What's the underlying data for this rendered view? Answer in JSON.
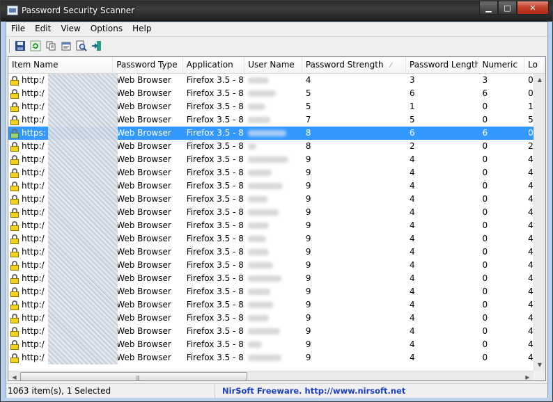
{
  "window": {
    "title": "Password Security Scanner"
  },
  "menu": [
    "File",
    "Edit",
    "View",
    "Options",
    "Help"
  ],
  "columns": [
    "Item Name",
    "Password Type",
    "Application",
    "User Name",
    "Password Strength",
    "Password Length",
    "Numeric",
    "Lo"
  ],
  "rows": [
    {
      "item": "http:/",
      "type": "Web Browser",
      "app": "Firefox 3.5 - 8",
      "strength": "4",
      "length": "3",
      "numeric": "3",
      "lo": "0"
    },
    {
      "item": "http:/",
      "type": "Web Browser",
      "app": "Firefox 3.5 - 8",
      "strength": "5",
      "length": "6",
      "numeric": "6",
      "lo": "0"
    },
    {
      "item": "http:/",
      "type": "Web Browser",
      "app": "Firefox 3.5 - 8",
      "strength": "5",
      "length": "1",
      "numeric": "0",
      "lo": "1"
    },
    {
      "item": "http:/",
      "type": "Web Browser",
      "app": "Firefox 3.5 - 8",
      "strength": "7",
      "length": "5",
      "numeric": "0",
      "lo": "5"
    },
    {
      "item": "https:",
      "type": "Web Browser",
      "app": "Firefox 3.5 - 8",
      "strength": "8",
      "length": "6",
      "numeric": "6",
      "lo": "0",
      "selected": true
    },
    {
      "item": "http:/",
      "type": "Web Browser",
      "app": "Firefox 3.5 - 8",
      "strength": "8",
      "length": "2",
      "numeric": "0",
      "lo": "2"
    },
    {
      "item": "http:/",
      "type": "Web Browser",
      "app": "Firefox 3.5 - 8",
      "strength": "9",
      "length": "4",
      "numeric": "0",
      "lo": "4"
    },
    {
      "item": "http:/",
      "type": "Web Browser",
      "app": "Firefox 3.5 - 8",
      "strength": "9",
      "length": "4",
      "numeric": "0",
      "lo": "4"
    },
    {
      "item": "http:/",
      "type": "Web Browser",
      "app": "Firefox 3.5 - 8",
      "strength": "9",
      "length": "4",
      "numeric": "0",
      "lo": "4"
    },
    {
      "item": "http:/",
      "type": "Web Browser",
      "app": "Firefox 3.5 - 8",
      "strength": "9",
      "length": "4",
      "numeric": "0",
      "lo": "4"
    },
    {
      "item": "http:/",
      "type": "Web Browser",
      "app": "Firefox 3.5 - 8",
      "strength": "9",
      "length": "4",
      "numeric": "0",
      "lo": "4"
    },
    {
      "item": "http:/",
      "type": "Web Browser",
      "app": "Firefox 3.5 - 8",
      "strength": "9",
      "length": "4",
      "numeric": "0",
      "lo": "4"
    },
    {
      "item": "http:/",
      "type": "Web Browser",
      "app": "Firefox 3.5 - 8",
      "strength": "9",
      "length": "4",
      "numeric": "0",
      "lo": "4"
    },
    {
      "item": "http:/",
      "type": "Web Browser",
      "app": "Firefox 3.5 - 8",
      "strength": "9",
      "length": "4",
      "numeric": "0",
      "lo": "4"
    },
    {
      "item": "http:/",
      "type": "Web Browser",
      "app": "Firefox 3.5 - 8",
      "strength": "9",
      "length": "4",
      "numeric": "0",
      "lo": "4"
    },
    {
      "item": "http:/",
      "type": "Web Browser",
      "app": "Firefox 3.5 - 8",
      "strength": "9",
      "length": "4",
      "numeric": "0",
      "lo": "4"
    },
    {
      "item": "http:/",
      "type": "Web Browser",
      "app": "Firefox 3.5 - 8",
      "strength": "9",
      "length": "4",
      "numeric": "0",
      "lo": "4"
    },
    {
      "item": "http:/",
      "type": "Web Browser",
      "app": "Firefox 3.5 - 8",
      "strength": "9",
      "length": "4",
      "numeric": "0",
      "lo": "4"
    },
    {
      "item": "http:/",
      "type": "Web Browser",
      "app": "Firefox 3.5 - 8",
      "strength": "9",
      "length": "4",
      "numeric": "0",
      "lo": "4"
    },
    {
      "item": "http:/",
      "type": "Web Browser",
      "app": "Firefox 3.5 - 8",
      "strength": "9",
      "length": "4",
      "numeric": "0",
      "lo": "4"
    },
    {
      "item": "http:/",
      "type": "Web Browser",
      "app": "Firefox 3.5 - 8",
      "strength": "9",
      "length": "4",
      "numeric": "0",
      "lo": "4"
    },
    {
      "item": "http:/",
      "type": "Web Browser",
      "app": "Firefox 3.5 - 8",
      "strength": "9",
      "length": "4",
      "numeric": "0",
      "lo": "4"
    }
  ],
  "status": {
    "count": "1063 item(s), 1 Selected",
    "link": "NirSoft Freeware.  http://www.nirsoft.net"
  },
  "colors": {
    "selection": "#3399ff",
    "link": "#1a3ec2"
  },
  "icons": [
    "save-icon",
    "refresh-icon",
    "copy-icon",
    "properties-icon",
    "find-icon",
    "exit-icon"
  ]
}
